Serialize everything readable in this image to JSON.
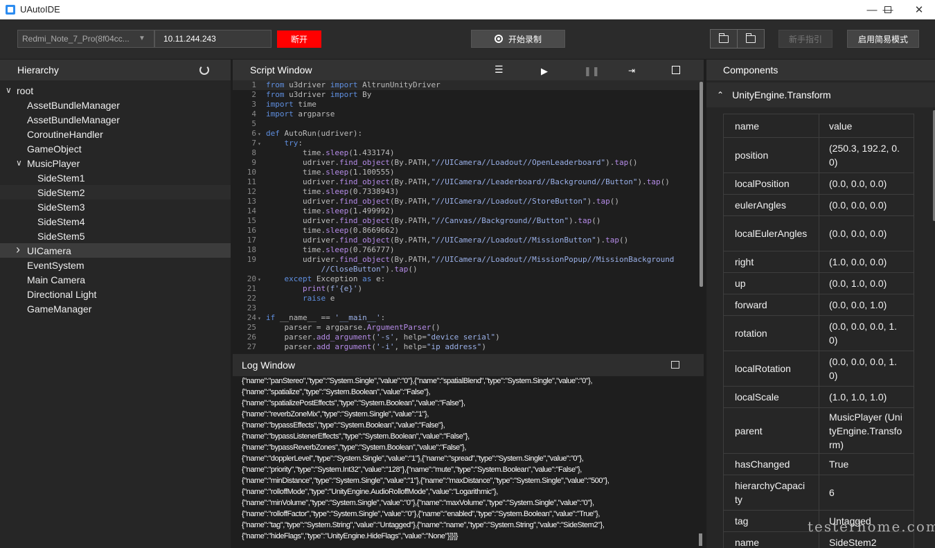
{
  "window": {
    "title": "UAutoIDE"
  },
  "toolbar": {
    "device": "Redmi_Note_7_Pro(8f04cc...",
    "ip": "10.11.244.243",
    "disconnect_label": "断开",
    "record_label": "开始录制",
    "guide_label": "新手指引",
    "simple_mode_label": "启用简易模式",
    "colors": {
      "disconnect": "#ff0000",
      "panel": "#262626"
    }
  },
  "hierarchy": {
    "title": "Hierarchy",
    "nodes": [
      {
        "label": "root",
        "depth": 0,
        "toggle": "expanded"
      },
      {
        "label": "AssetBundleManager",
        "depth": 1
      },
      {
        "label": "AssetBundleManager",
        "depth": 1
      },
      {
        "label": "CoroutineHandler",
        "depth": 1
      },
      {
        "label": "GameObject",
        "depth": 1
      },
      {
        "label": "MusicPlayer",
        "depth": 1,
        "toggle": "expanded"
      },
      {
        "label": "SideStem1",
        "depth": 2
      },
      {
        "label": "SideStem2",
        "depth": 2,
        "selected": true
      },
      {
        "label": "SideStem3",
        "depth": 2
      },
      {
        "label": "SideStem4",
        "depth": 2
      },
      {
        "label": "SideStem5",
        "depth": 2
      },
      {
        "label": "UICamera",
        "depth": 1,
        "toggle": "collapsed",
        "highlight": true
      },
      {
        "label": "EventSystem",
        "depth": 1
      },
      {
        "label": "Main Camera",
        "depth": 1
      },
      {
        "label": "Directional Light",
        "depth": 1
      },
      {
        "label": "GameManager",
        "depth": 1
      }
    ]
  },
  "script": {
    "title": "Script Window",
    "lines": [
      {
        "n": "1",
        "html": "<span class='k'>from</span> u3driver <span class='k'>import</span> AltrunUnityDriver"
      },
      {
        "n": "2",
        "html": "<span class='k'>from</span> u3driver <span class='k'>import</span> By"
      },
      {
        "n": "3",
        "html": "<span class='k'>import</span> time"
      },
      {
        "n": "4",
        "html": "<span class='k'>import</span> argparse"
      },
      {
        "n": "5",
        "html": ""
      },
      {
        "n": "6",
        "fold": true,
        "html": "<span class='k'>def</span> AutoRun(udriver):"
      },
      {
        "n": "7",
        "fold": true,
        "html": "    <span class='k'>try</span>:"
      },
      {
        "n": "8",
        "html": "        time.<span class='f'>sleep</span>(1.433174)"
      },
      {
        "n": "9",
        "html": "        udriver.<span class='f'>find_object</span>(By.PATH,<span class='s'>\"//UICamera//Loadout//OpenLeaderboard\"</span>).<span class='f'>tap</span>()"
      },
      {
        "n": "10",
        "html": "        time.<span class='f'>sleep</span>(1.100555)"
      },
      {
        "n": "11",
        "html": "        udriver.<span class='f'>find_object</span>(By.PATH,<span class='s'>\"//UICamera//Leaderboard//Background//Button\"</span>).<span class='f'>tap</span>()"
      },
      {
        "n": "12",
        "html": "        time.<span class='f'>sleep</span>(0.7338943)"
      },
      {
        "n": "13",
        "html": "        udriver.<span class='f'>find_object</span>(By.PATH,<span class='s'>\"//UICamera//Loadout//StoreButton\"</span>).<span class='f'>tap</span>()"
      },
      {
        "n": "14",
        "html": "        time.<span class='f'>sleep</span>(1.499992)"
      },
      {
        "n": "15",
        "html": "        udriver.<span class='f'>find_object</span>(By.PATH,<span class='s'>\"//Canvas//Background//Button\"</span>).<span class='f'>tap</span>()"
      },
      {
        "n": "16",
        "html": "        time.<span class='f'>sleep</span>(0.8669662)"
      },
      {
        "n": "17",
        "html": "        udriver.<span class='f'>find_object</span>(By.PATH,<span class='s'>\"//UICamera//Loadout//MissionButton\"</span>).<span class='f'>tap</span>()"
      },
      {
        "n": "18",
        "html": "        time.<span class='f'>sleep</span>(0.766777)"
      },
      {
        "n": "19",
        "html": "        udriver.<span class='f'>find_object</span>(By.PATH,<span class='s'>\"//UICamera//Loadout//MissionPopup//MissionBackground</span>"
      },
      {
        "n": "",
        "html": "            <span class='s'>//CloseButton\"</span>).<span class='f'>tap</span>()"
      },
      {
        "n": "20",
        "fold": true,
        "html": "    <span class='k'>except</span> Exception <span class='k'>as</span> e:"
      },
      {
        "n": "21",
        "html": "        <span class='f'>print</span>(<span class='s'>f'{e}'</span>)"
      },
      {
        "n": "22",
        "html": "        <span class='k'>raise</span> e"
      },
      {
        "n": "23",
        "html": ""
      },
      {
        "n": "24",
        "fold": true,
        "html": "<span class='k'>if</span> __name__ == <span class='s'>'__main__'</span>:"
      },
      {
        "n": "25",
        "html": "    parser = argparse.<span class='f'>ArgumentParser</span>()"
      },
      {
        "n": "26",
        "html": "    parser.<span class='f'>add_argument</span>(<span class='s'>'-s'</span>, help=<span class='s'>\"device serial\"</span>)"
      },
      {
        "n": "27",
        "html": "    parser.<span class='f'>add_argument</span>(<span class='s'>'-i'</span>, help=<span class='s'>\"ip address\"</span>)"
      }
    ]
  },
  "log": {
    "title": "Log Window",
    "lines": [
      "{\"name\":\"panStereo\",\"type\":\"System.Single\",\"value\":\"0\"},{\"name\":\"spatialBlend\",\"type\":\"System.Single\",\"value\":\"0\"},",
      "{\"name\":\"spatialize\",\"type\":\"System.Boolean\",\"value\":\"False\"},",
      "{\"name\":\"spatializePostEffects\",\"type\":\"System.Boolean\",\"value\":\"False\"},",
      "{\"name\":\"reverbZoneMix\",\"type\":\"System.Single\",\"value\":\"1\"},",
      "{\"name\":\"bypassEffects\",\"type\":\"System.Boolean\",\"value\":\"False\"},",
      "{\"name\":\"bypassListenerEffects\",\"type\":\"System.Boolean\",\"value\":\"False\"},",
      "{\"name\":\"bypassReverbZones\",\"type\":\"System.Boolean\",\"value\":\"False\"},",
      "{\"name\":\"dopplerLevel\",\"type\":\"System.Single\",\"value\":\"1\"},{\"name\":\"spread\",\"type\":\"System.Single\",\"value\":\"0\"},",
      "{\"name\":\"priority\",\"type\":\"System.Int32\",\"value\":\"128\"},{\"name\":\"mute\",\"type\":\"System.Boolean\",\"value\":\"False\"},",
      "{\"name\":\"minDistance\",\"type\":\"System.Single\",\"value\":\"1\"},{\"name\":\"maxDistance\",\"type\":\"System.Single\",\"value\":\"500\"},",
      "{\"name\":\"rolloffMode\",\"type\":\"UnityEngine.AudioRolloffMode\",\"value\":\"Logarithmic\"},",
      "{\"name\":\"minVolume\",\"type\":\"System.Single\",\"value\":\"0\"},{\"name\":\"maxVolume\",\"type\":\"System.Single\",\"value\":\"0\"},",
      "{\"name\":\"rolloffFactor\",\"type\":\"System.Single\",\"value\":\"0\"},{\"name\":\"enabled\",\"type\":\"System.Boolean\",\"value\":\"True\"},",
      "{\"name\":\"tag\",\"type\":\"System.String\",\"value\":\"Untagged\"},{\"name\":\"name\",\"type\":\"System.String\",\"value\":\"SideStem2\"},",
      "{\"name\":\"hideFlags\",\"type\":\"UnityEngine.HideFlags\",\"value\":\"None\"}]}]}"
    ]
  },
  "components": {
    "title": "Components",
    "component_name": "UnityEngine.Transform",
    "header": [
      "name",
      "value"
    ],
    "rows": [
      [
        "position",
        "(250.3, 192.2, 0.0)"
      ],
      [
        "localPosition",
        "(0.0, 0.0, 0.0)"
      ],
      [
        "eulerAngles",
        "(0.0, 0.0, 0.0)"
      ],
      [
        "localEulerAngles",
        "(0.0, 0.0, 0.0)"
      ],
      [
        "right",
        "(1.0, 0.0, 0.0)"
      ],
      [
        "up",
        "(0.0, 1.0, 0.0)"
      ],
      [
        "forward",
        "(0.0, 0.0, 1.0)"
      ],
      [
        "rotation",
        "(0.0, 0.0, 0.0, 1.0)"
      ],
      [
        "localRotation",
        "(0.0, 0.0, 0.0, 1.0)"
      ],
      [
        "localScale",
        "(1.0, 1.0, 1.0)"
      ],
      [
        "parent",
        "MusicPlayer (UnityEngine.Transform)"
      ],
      [
        "hasChanged",
        "True"
      ],
      [
        "hierarchyCapacity",
        "6"
      ],
      [
        "tag",
        "Untagged"
      ],
      [
        "name",
        "SideStem2"
      ]
    ]
  },
  "watermark": "testerhome.com"
}
